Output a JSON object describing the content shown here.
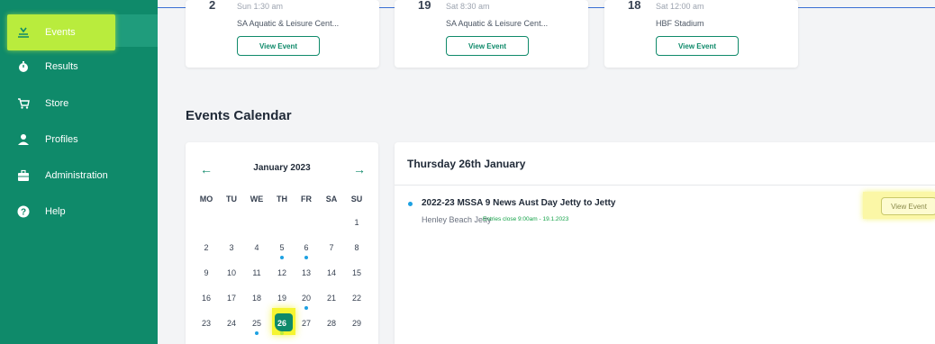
{
  "sidebar": {
    "items": [
      {
        "label": "Events",
        "icon": "events-icon"
      },
      {
        "label": "Results",
        "icon": "stopwatch-icon"
      },
      {
        "label": "Store",
        "icon": "cart-icon"
      },
      {
        "label": "Profiles",
        "icon": "person-icon"
      },
      {
        "label": "Administration",
        "icon": "briefcase-icon"
      },
      {
        "label": "Help",
        "icon": "help-icon"
      }
    ]
  },
  "top_cards": [
    {
      "num": "2",
      "time": "Sun 1:30 am",
      "venue": "SA Aquatic & Leisure Cent...",
      "button": "View Event"
    },
    {
      "num": "19",
      "time": "Sat 8:30 am",
      "venue": "SA Aquatic & Leisure Cent...",
      "button": "View Event"
    },
    {
      "num": "18",
      "time": "Sat 12:00 am",
      "venue": "HBF Stadium",
      "button": "View Event"
    }
  ],
  "calendar": {
    "section_title": "Events Calendar",
    "month": "January 2023",
    "prev_icon": "←",
    "next_icon": "→",
    "weekdays": [
      "MO",
      "TU",
      "WE",
      "TH",
      "FR",
      "SA",
      "SU"
    ],
    "rows": [
      [
        "",
        "",
        "",
        "",
        "",
        "",
        "1"
      ],
      [
        "2",
        "3",
        "4",
        "5",
        "6",
        "7",
        "8"
      ],
      [
        "9",
        "10",
        "11",
        "12",
        "13",
        "14",
        "15"
      ],
      [
        "16",
        "17",
        "18",
        "19",
        "20",
        "21",
        "22"
      ],
      [
        "23",
        "24",
        "25",
        "26",
        "27",
        "28",
        "29"
      ]
    ],
    "event_days": [
      "5",
      "6",
      "20",
      "25",
      "26"
    ],
    "selected_day": "26"
  },
  "event_panel": {
    "title": "Thursday 26th January",
    "events": [
      {
        "name": "2022-23 MSSA 9 News Aust Day Jetty to Jetty",
        "location": "Henley Beach Jetty",
        "entries_close": "Entries close 9:00am - 19.1.2023",
        "button": "View Event"
      }
    ]
  },
  "colors": {
    "sidebar": "#0f8a6a",
    "accent_green": "#0f8a6a",
    "highlight_yellow": "#f5f530",
    "event_dot": "#1da1e2"
  }
}
